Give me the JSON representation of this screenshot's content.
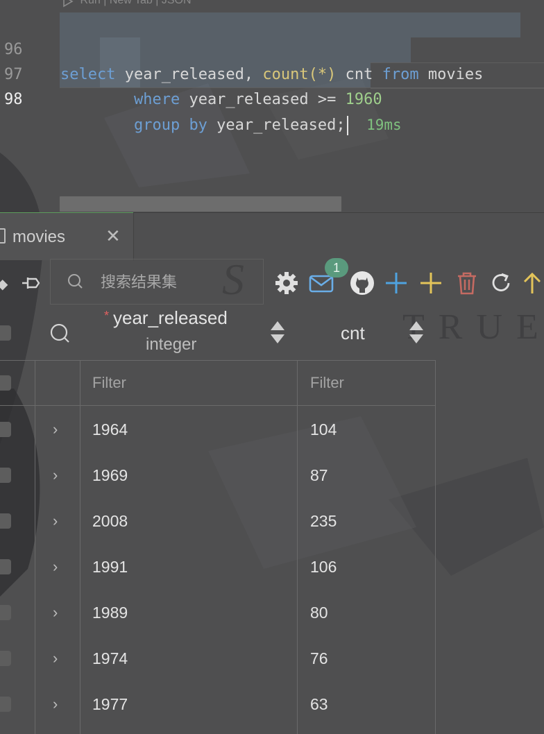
{
  "editor": {
    "codelens": "Run | New Tab | JSON",
    "lines": [
      {
        "num": "96",
        "tokens": [
          [
            "kw",
            "select"
          ],
          [
            "id",
            " year_released, "
          ],
          [
            "fn",
            "count"
          ],
          [
            "fn",
            "(*)"
          ],
          [
            "id",
            " cnt "
          ],
          [
            "kw",
            "from"
          ],
          [
            "id",
            " movies"
          ]
        ]
      },
      {
        "num": "97",
        "tokens": [
          [
            "id",
            "        "
          ],
          [
            "kw",
            "where"
          ],
          [
            "id",
            " year_released >= "
          ],
          [
            "num",
            "1960"
          ]
        ]
      },
      {
        "num": "98",
        "tokens": [
          [
            "id",
            "        "
          ],
          [
            "kw",
            "group by"
          ],
          [
            "id",
            " year_released;"
          ]
        ]
      }
    ],
    "timing": "19ms"
  },
  "result_tab": {
    "label": "movies"
  },
  "toolbar": {
    "search_placeholder": "搜索结果集",
    "mail_badge": "1",
    "icons": [
      "settings-icon",
      "mail-icon",
      "github-icon",
      "add-row-icon",
      "add-column-icon",
      "delete-icon",
      "refresh-icon",
      "export-icon"
    ],
    "colors": {
      "settings": "#e0e0e0",
      "mail": "#6aaee8",
      "github": "#e6e6e6",
      "add_blue": "#4fa3e0",
      "add_yellow": "#e3c45a",
      "delete": "#c46a62",
      "refresh": "#e0e0e0",
      "export": "#e3c45a"
    }
  },
  "columns": [
    {
      "name": "year_released",
      "type": "integer",
      "required_mark": "*",
      "filter_placeholder": "Filter"
    },
    {
      "name": "cnt",
      "type": "",
      "filter_placeholder": "Filter"
    }
  ],
  "rows": [
    {
      "year_released": "1964",
      "cnt": "104"
    },
    {
      "year_released": "1969",
      "cnt": "87"
    },
    {
      "year_released": "2008",
      "cnt": "235"
    },
    {
      "year_released": "1991",
      "cnt": "106"
    },
    {
      "year_released": "1989",
      "cnt": "80"
    },
    {
      "year_released": "1974",
      "cnt": "76"
    },
    {
      "year_released": "1977",
      "cnt": "63"
    }
  ]
}
